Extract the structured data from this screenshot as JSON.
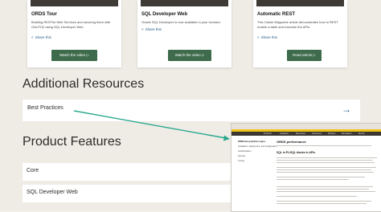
{
  "cards": [
    {
      "title": "ORDS Tour",
      "description": "Building RESTful Web Services and securing them with OAUTH2 using SQL Developer Web.",
      "share": "Share this",
      "button": "Watch the video"
    },
    {
      "title": "SQL Developer Web",
      "description": "Oracle SQL Developer is now available in your browser.",
      "share": "Share this",
      "button": "Watch the video"
    },
    {
      "title": "Automatic REST",
      "description": "This Oracle Magazine article demonstrates how to REST enable a table and examine the APIs.",
      "share": "Share this",
      "button": "Read article"
    }
  ],
  "icons": {
    "share": "share-icon",
    "button_arrow": "play-arrow-icon",
    "row_arrow": "arrow-right-icon"
  },
  "colors": {
    "button_bg": "#3e6b4b",
    "link": "#2b5f8a",
    "annotation_arrow": "#2aa78e",
    "accent_yellow": "#f0c419"
  },
  "additional_resources": {
    "heading": "Additional Resources",
    "items": [
      {
        "label": "Best Practices"
      }
    ]
  },
  "product_features": {
    "heading": "Product Features",
    "items": [
      {
        "label": "Core"
      },
      {
        "label": "SQL Developer Web"
      }
    ]
  },
  "preview": {
    "nav": [
      "Products",
      "Industries",
      "Resources",
      "Customers",
      "Partners",
      "Developers",
      "Events"
    ],
    "sidebar": [
      "ORDS best practices topics",
      "Installation, deployment, and configuration",
      "Authentication",
      "Security",
      "Tuning"
    ],
    "heading": "ORDS performance",
    "subheading": "SQL in PL/SQL blocks in APIs"
  }
}
